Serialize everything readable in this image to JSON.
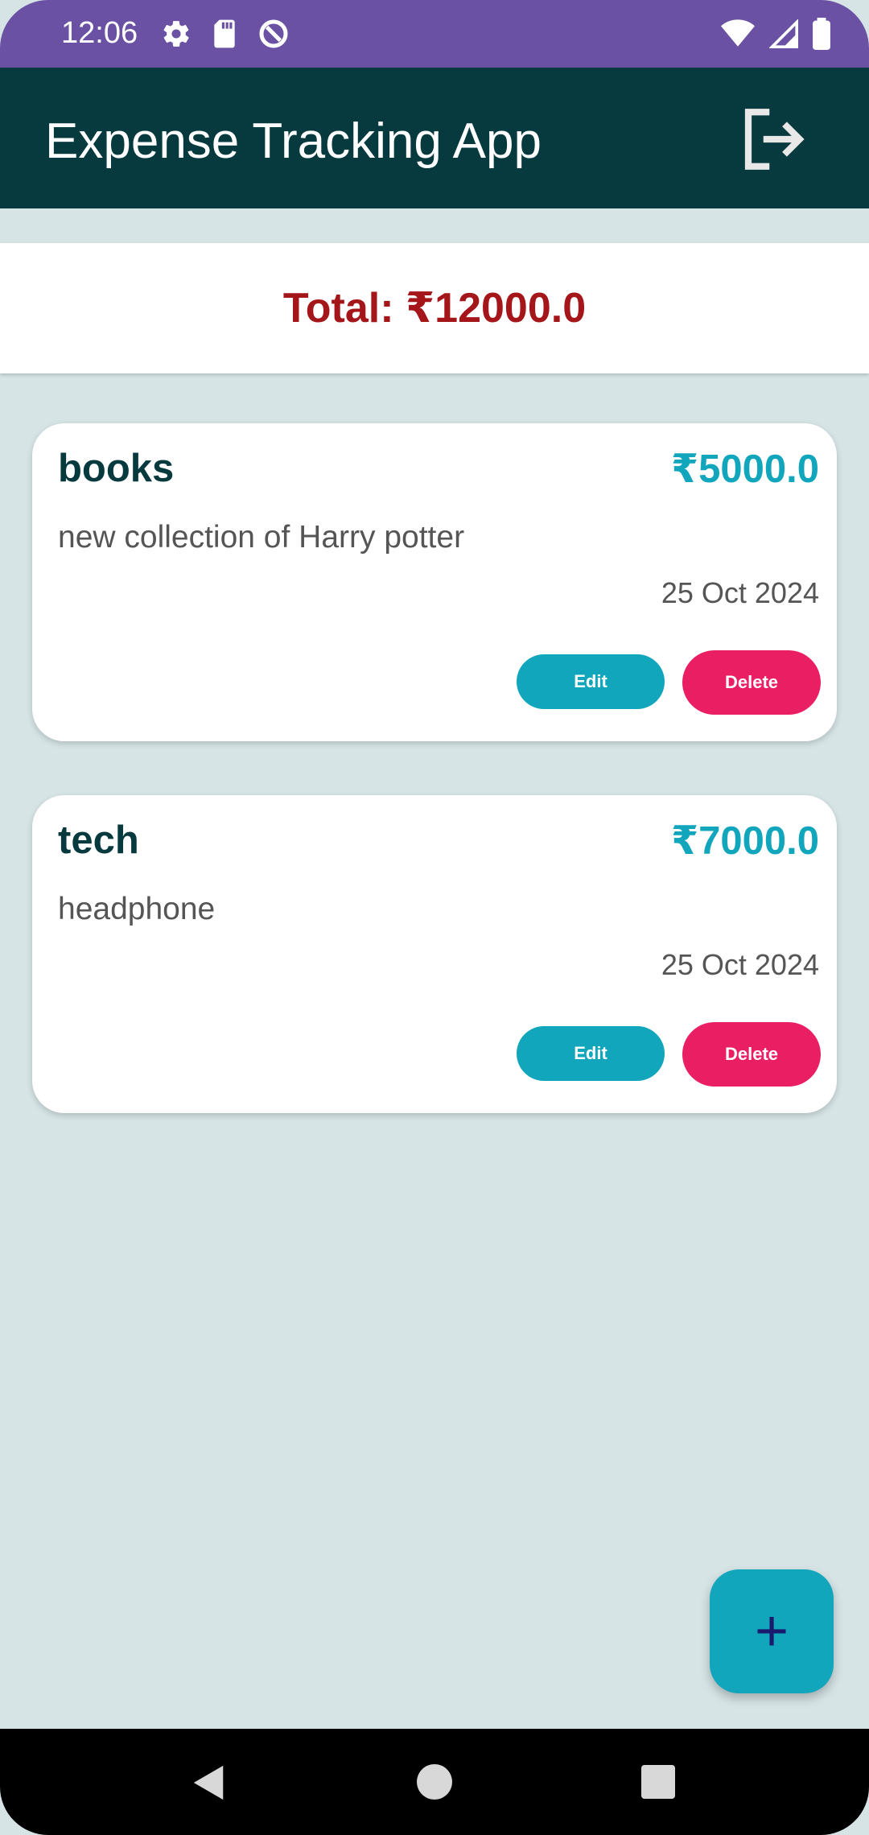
{
  "status_bar": {
    "time": "12:06",
    "left_icons": [
      "gear-icon",
      "sd-card-icon",
      "data-saver-icon"
    ],
    "right_icons": [
      "wifi-icon",
      "signal-icon",
      "battery-icon"
    ]
  },
  "app_bar": {
    "title": "Expense Tracking App",
    "action_icon": "logout-icon"
  },
  "total": {
    "label": "Total: ₹12000.0",
    "color": "#a5161b"
  },
  "expenses": [
    {
      "title": "books",
      "amount": "₹5000.0",
      "description": "new collection of Harry potter",
      "date": "25 Oct 2024",
      "edit_label": "Edit",
      "delete_label": "Delete"
    },
    {
      "title": "tech",
      "amount": "₹7000.0",
      "description": "headphone",
      "date": "25 Oct 2024",
      "edit_label": "Edit",
      "delete_label": "Delete"
    }
  ],
  "fab": {
    "icon": "plus-icon",
    "symbol": "+"
  },
  "nav_bar": {
    "icons": [
      "back-icon",
      "home-icon",
      "recents-icon"
    ]
  },
  "colors": {
    "status_bar": "#6a51a4",
    "app_bar": "#073a3f",
    "background": "#d6e4e6",
    "accent": "#12a6bc",
    "delete": "#e91e63"
  }
}
